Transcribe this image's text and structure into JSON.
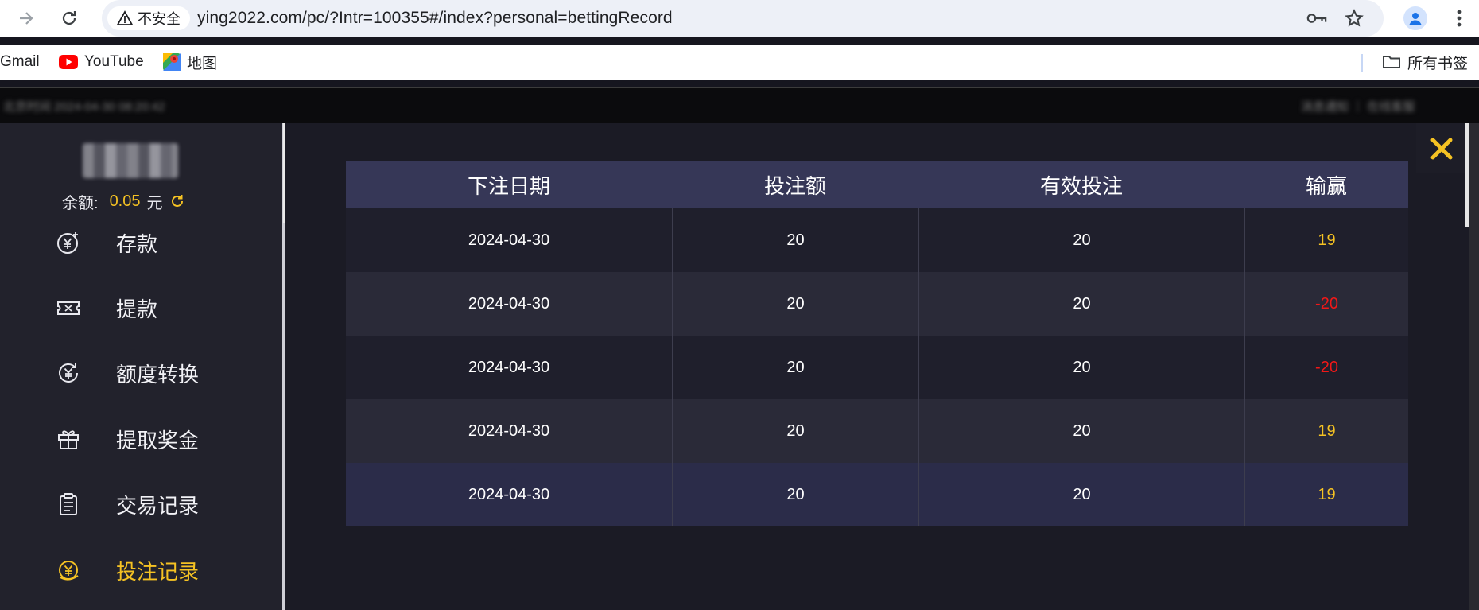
{
  "browser": {
    "security_label": "不安全",
    "url": "ying2022.com/pc/?Intr=100355#/index?personal=bettingRecord",
    "bookmarks": [
      {
        "label": "Gmail"
      },
      {
        "label": "YouTube"
      },
      {
        "label": "地图"
      }
    ],
    "all_bookmarks_label": "所有书签"
  },
  "header_strip": {
    "left_text": "北京时间 2024-04-30 08:20:42",
    "right_text": "消息通知 ｜ 在线客服"
  },
  "sidebar": {
    "balance_label": "余额:",
    "balance_value": "0.05",
    "balance_unit": "元",
    "items": [
      {
        "label": "存款",
        "icon": "yen-coin-plus-icon",
        "active": false
      },
      {
        "label": "提款",
        "icon": "ticket-icon",
        "active": false
      },
      {
        "label": "额度转换",
        "icon": "yen-exchange-icon",
        "active": false
      },
      {
        "label": "提取奖金",
        "icon": "gift-icon",
        "active": false
      },
      {
        "label": "交易记录",
        "icon": "clipboard-list-icon",
        "active": false
      },
      {
        "label": "投注记录",
        "icon": "betting-record-icon",
        "active": true
      }
    ]
  },
  "table": {
    "headers": [
      "下注日期",
      "投注额",
      "有效投注",
      "输赢"
    ],
    "rows": [
      {
        "date": "2024-04-30",
        "stake": "20",
        "valid": "20",
        "result": "19",
        "status": "win"
      },
      {
        "date": "2024-04-30",
        "stake": "20",
        "valid": "20",
        "result": "-20",
        "status": "loss"
      },
      {
        "date": "2024-04-30",
        "stake": "20",
        "valid": "20",
        "result": "-20",
        "status": "loss"
      },
      {
        "date": "2024-04-30",
        "stake": "20",
        "valid": "20",
        "result": "19",
        "status": "win"
      },
      {
        "date": "2024-04-30",
        "stake": "20",
        "valid": "20",
        "result": "19",
        "status": "win"
      }
    ]
  },
  "colors": {
    "accent": "#f5c223",
    "loss": "#f21818",
    "header_bg": "#363757",
    "sidebar_bg": "#22222c"
  }
}
